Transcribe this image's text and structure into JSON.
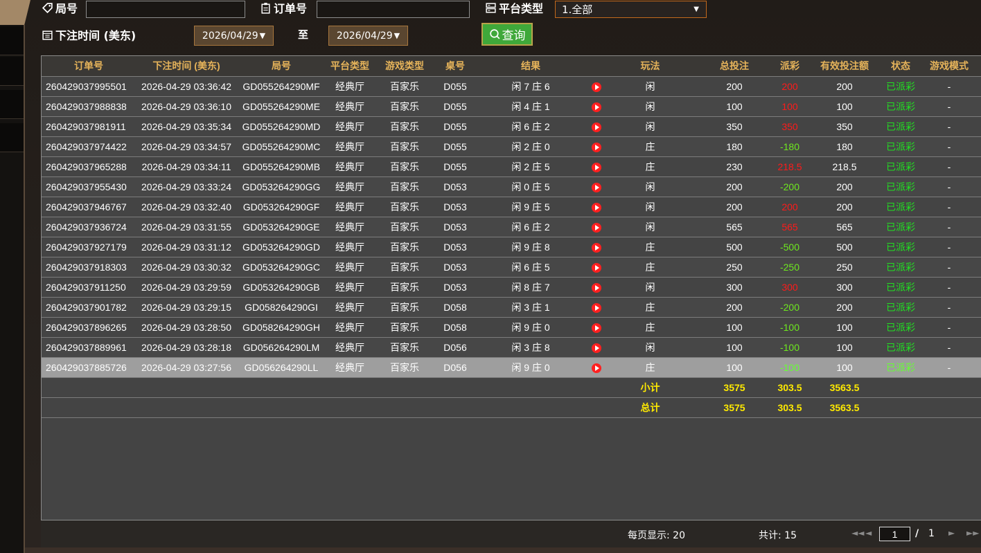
{
  "filters": {
    "round_label": "局号",
    "round_value": "",
    "order_label": "订单号",
    "order_value": "",
    "platform_label": "平台类型",
    "platform_selected": "1.全部",
    "time_label": "下注时间 (美东)",
    "date_from": "2026/04/29",
    "date_to_label": "至",
    "date_to": "2026/04/29",
    "query_label": "查询"
  },
  "table": {
    "headers": [
      "订单号",
      "下注时间 (美东)",
      "局号",
      "平台类型",
      "游戏类型",
      "桌号",
      "结果",
      "",
      "玩法",
      "总投注",
      "派彩",
      "有效投注额",
      "状态",
      "游戏模式"
    ],
    "rows": [
      {
        "order": "260429037995501",
        "time": "2026-04-29 03:36:42",
        "round": "GD055264290MF",
        "platform": "经典厅",
        "game": "百家乐",
        "table": "D055",
        "result": "闲 7 庄 6",
        "play": "闲",
        "bet": "200",
        "payout": "200",
        "payout_sign": "pos",
        "valid": "200",
        "status": "已派彩",
        "mode": "-"
      },
      {
        "order": "260429037988838",
        "time": "2026-04-29 03:36:10",
        "round": "GD055264290ME",
        "platform": "经典厅",
        "game": "百家乐",
        "table": "D055",
        "result": "闲 4 庄 1",
        "play": "闲",
        "bet": "100",
        "payout": "100",
        "payout_sign": "pos",
        "valid": "100",
        "status": "已派彩",
        "mode": "-"
      },
      {
        "order": "260429037981911",
        "time": "2026-04-29 03:35:34",
        "round": "GD055264290MD",
        "platform": "经典厅",
        "game": "百家乐",
        "table": "D055",
        "result": "闲 6 庄 2",
        "play": "闲",
        "bet": "350",
        "payout": "350",
        "payout_sign": "pos",
        "valid": "350",
        "status": "已派彩",
        "mode": "-"
      },
      {
        "order": "260429037974422",
        "time": "2026-04-29 03:34:57",
        "round": "GD055264290MC",
        "platform": "经典厅",
        "game": "百家乐",
        "table": "D055",
        "result": "闲 2 庄 0",
        "play": "庄",
        "bet": "180",
        "payout": "-180",
        "payout_sign": "neg",
        "valid": "180",
        "status": "已派彩",
        "mode": "-"
      },
      {
        "order": "260429037965288",
        "time": "2026-04-29 03:34:11",
        "round": "GD055264290MB",
        "platform": "经典厅",
        "game": "百家乐",
        "table": "D055",
        "result": "闲 2 庄 5",
        "play": "庄",
        "bet": "230",
        "payout": "218.5",
        "payout_sign": "pos",
        "valid": "218.5",
        "status": "已派彩",
        "mode": "-"
      },
      {
        "order": "260429037955430",
        "time": "2026-04-29 03:33:24",
        "round": "GD053264290GG",
        "platform": "经典厅",
        "game": "百家乐",
        "table": "D053",
        "result": "闲 0 庄 5",
        "play": "闲",
        "bet": "200",
        "payout": "-200",
        "payout_sign": "neg",
        "valid": "200",
        "status": "已派彩",
        "mode": "-"
      },
      {
        "order": "260429037946767",
        "time": "2026-04-29 03:32:40",
        "round": "GD053264290GF",
        "platform": "经典厅",
        "game": "百家乐",
        "table": "D053",
        "result": "闲 9 庄 5",
        "play": "闲",
        "bet": "200",
        "payout": "200",
        "payout_sign": "pos",
        "valid": "200",
        "status": "已派彩",
        "mode": "-"
      },
      {
        "order": "260429037936724",
        "time": "2026-04-29 03:31:55",
        "round": "GD053264290GE",
        "platform": "经典厅",
        "game": "百家乐",
        "table": "D053",
        "result": "闲 6 庄 2",
        "play": "闲",
        "bet": "565",
        "payout": "565",
        "payout_sign": "pos",
        "valid": "565",
        "status": "已派彩",
        "mode": "-"
      },
      {
        "order": "260429037927179",
        "time": "2026-04-29 03:31:12",
        "round": "GD053264290GD",
        "platform": "经典厅",
        "game": "百家乐",
        "table": "D053",
        "result": "闲 9 庄 8",
        "play": "庄",
        "bet": "500",
        "payout": "-500",
        "payout_sign": "neg",
        "valid": "500",
        "status": "已派彩",
        "mode": "-"
      },
      {
        "order": "260429037918303",
        "time": "2026-04-29 03:30:32",
        "round": "GD053264290GC",
        "platform": "经典厅",
        "game": "百家乐",
        "table": "D053",
        "result": "闲 6 庄 5",
        "play": "庄",
        "bet": "250",
        "payout": "-250",
        "payout_sign": "neg",
        "valid": "250",
        "status": "已派彩",
        "mode": "-"
      },
      {
        "order": "260429037911250",
        "time": "2026-04-29 03:29:59",
        "round": "GD053264290GB",
        "platform": "经典厅",
        "game": "百家乐",
        "table": "D053",
        "result": "闲 8 庄 7",
        "play": "闲",
        "bet": "300",
        "payout": "300",
        "payout_sign": "pos",
        "valid": "300",
        "status": "已派彩",
        "mode": "-"
      },
      {
        "order": "260429037901782",
        "time": "2026-04-29 03:29:15",
        "round": "GD058264290GI",
        "platform": "经典厅",
        "game": "百家乐",
        "table": "D058",
        "result": "闲 3 庄 1",
        "play": "庄",
        "bet": "200",
        "payout": "-200",
        "payout_sign": "neg",
        "valid": "200",
        "status": "已派彩",
        "mode": "-"
      },
      {
        "order": "260429037896265",
        "time": "2026-04-29 03:28:50",
        "round": "GD058264290GH",
        "platform": "经典厅",
        "game": "百家乐",
        "table": "D058",
        "result": "闲 9 庄 0",
        "play": "庄",
        "bet": "100",
        "payout": "-100",
        "payout_sign": "neg",
        "valid": "100",
        "status": "已派彩",
        "mode": "-"
      },
      {
        "order": "260429037889961",
        "time": "2026-04-29 03:28:18",
        "round": "GD056264290LM",
        "platform": "经典厅",
        "game": "百家乐",
        "table": "D056",
        "result": "闲 3 庄 8",
        "play": "闲",
        "bet": "100",
        "payout": "-100",
        "payout_sign": "neg",
        "valid": "100",
        "status": "已派彩",
        "mode": "-"
      },
      {
        "order": "260429037885726",
        "time": "2026-04-29 03:27:56",
        "round": "GD056264290LL",
        "platform": "经典厅",
        "game": "百家乐",
        "table": "D056",
        "result": "闲 9 庄 0",
        "play": "庄",
        "bet": "100",
        "payout": "-100",
        "payout_sign": "neg",
        "valid": "100",
        "status": "已派彩",
        "mode": "-",
        "selected": true
      }
    ],
    "subtotal": {
      "label": "小计",
      "bet": "3575",
      "payout": "303.5",
      "valid": "3563.5"
    },
    "total": {
      "label": "总计",
      "bet": "3575",
      "payout": "303.5",
      "valid": "3563.5"
    }
  },
  "footer": {
    "page_size": "每页显示: 20",
    "total_count": "共计: 15",
    "current_page": "1",
    "page_separator": "/",
    "total_pages": "1"
  },
  "colors": {
    "header_text": "#e5b35a",
    "positive_payout": "#ff1a1a",
    "negative_payout": "#6ee81f",
    "status_text": "#22e022",
    "sum_text": "#ffea00",
    "query_button": "#3fa83a"
  }
}
